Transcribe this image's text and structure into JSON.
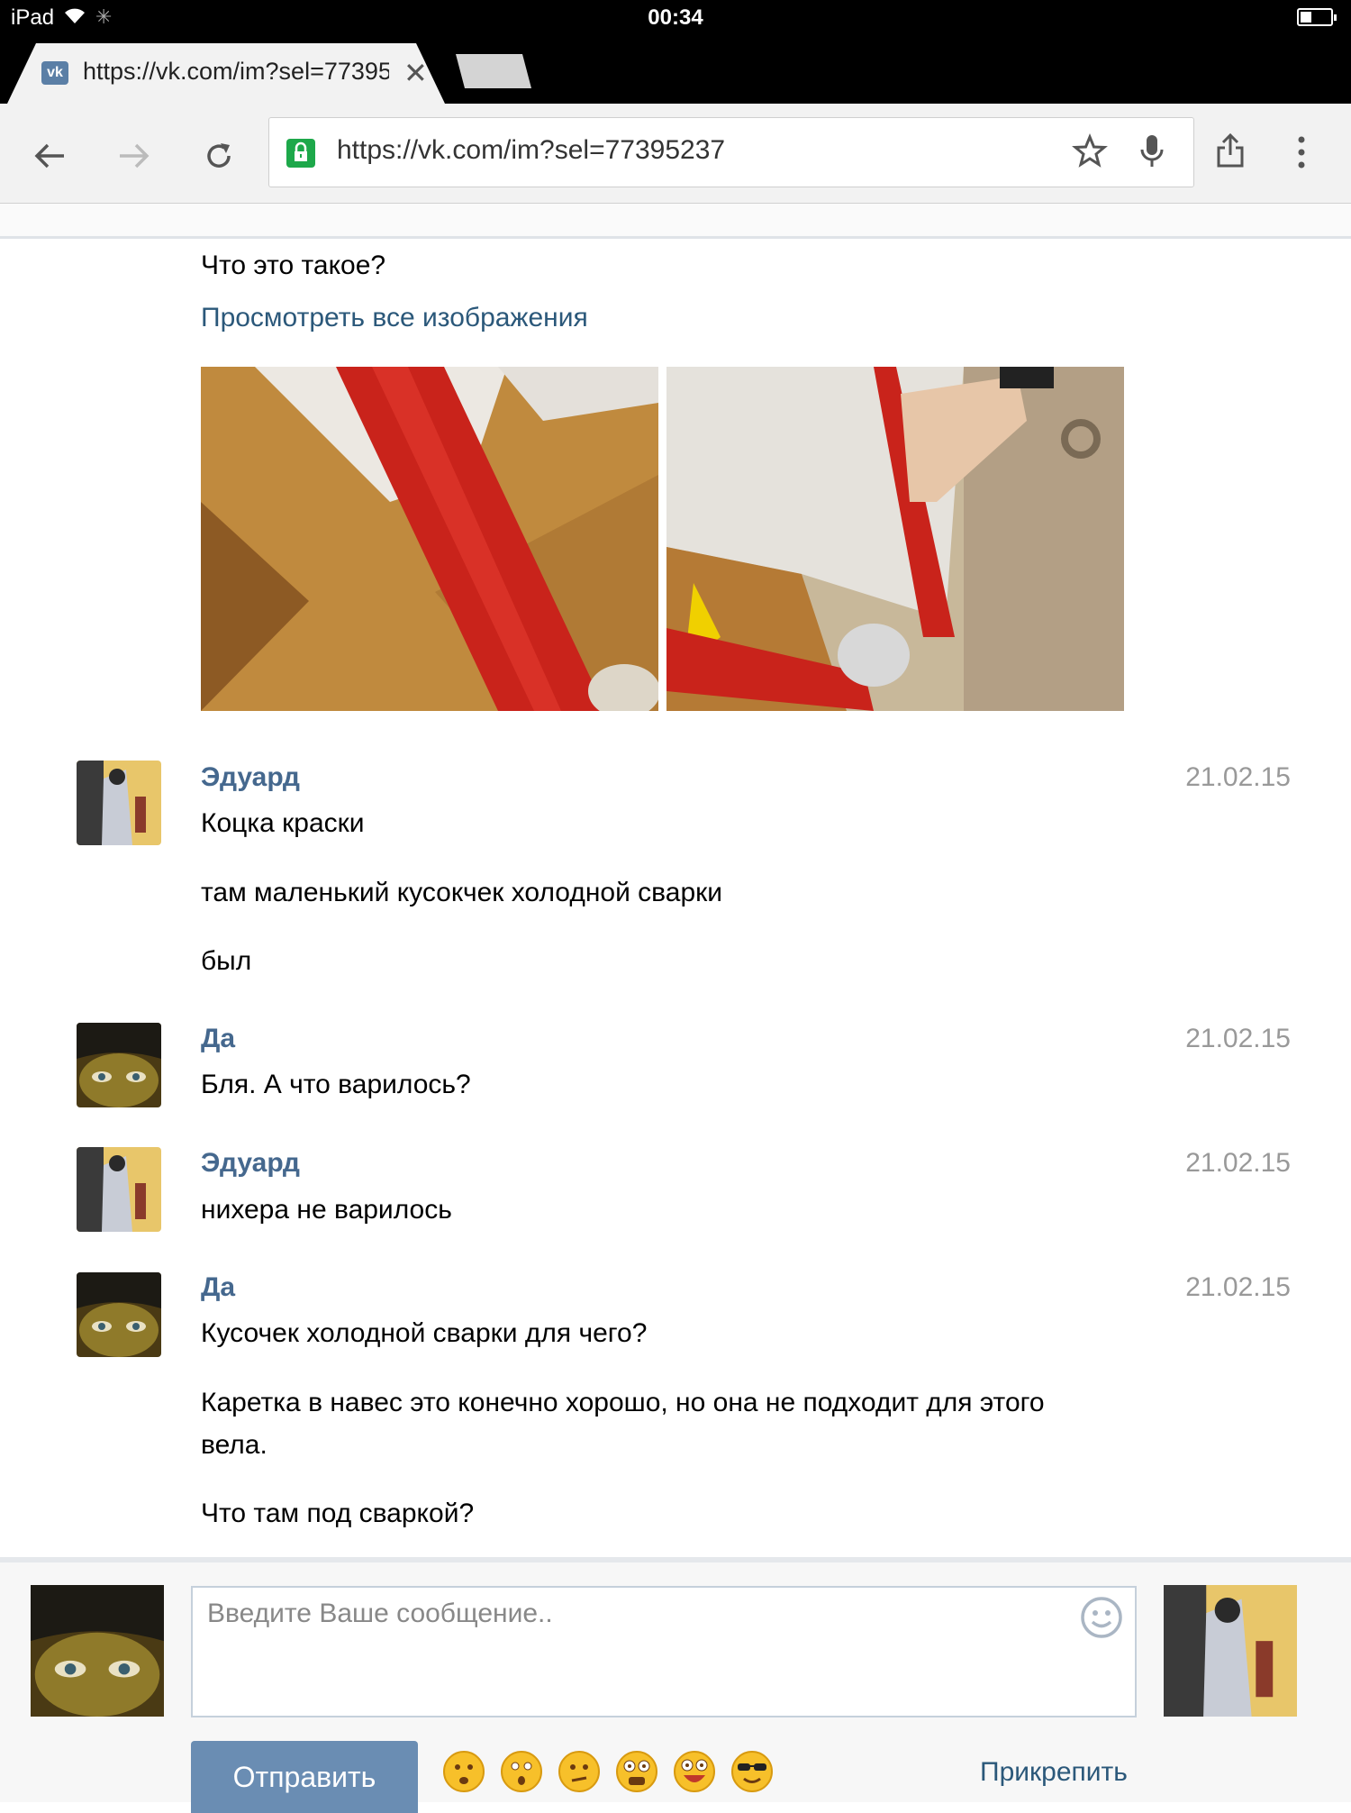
{
  "status_bar": {
    "carrier": "iPad",
    "time": "00:34"
  },
  "browser": {
    "tab_title": "https://vk.com/im?sel=77395237",
    "tab_favicon": "vk",
    "url": "https://vk.com/im?sel=77395237"
  },
  "conversation": {
    "top_text": "Что это такое?",
    "view_all_images": "Просмотреть все изображения",
    "messages": [
      {
        "author": "Эдуард",
        "date": "21.02.15",
        "lines": [
          "Коцка краски",
          "там маленький кусокчек холодной сварки",
          "был"
        ]
      },
      {
        "author": "Да",
        "date": "21.02.15",
        "lines": [
          "Бля. А что варилось?"
        ]
      },
      {
        "author": "Эдуард",
        "date": "21.02.15",
        "lines": [
          "нихера не варилось"
        ]
      },
      {
        "author": "Да",
        "date": "21.02.15",
        "lines": [
          "Кусочек холодной сварки для чего?",
          "Каретка в навес это конечно хорошо, но она не подходит для этого",
          "вела.",
          "Что там под сваркой?"
        ]
      }
    ]
  },
  "composer": {
    "placeholder": "Введите Ваше сообщение..",
    "send_label": "Отправить",
    "attach_label": "Прикрепить"
  },
  "colors": {
    "accent": "#45688e",
    "link": "#2b587a",
    "send_button": "#6a8db3",
    "date": "#999999"
  }
}
